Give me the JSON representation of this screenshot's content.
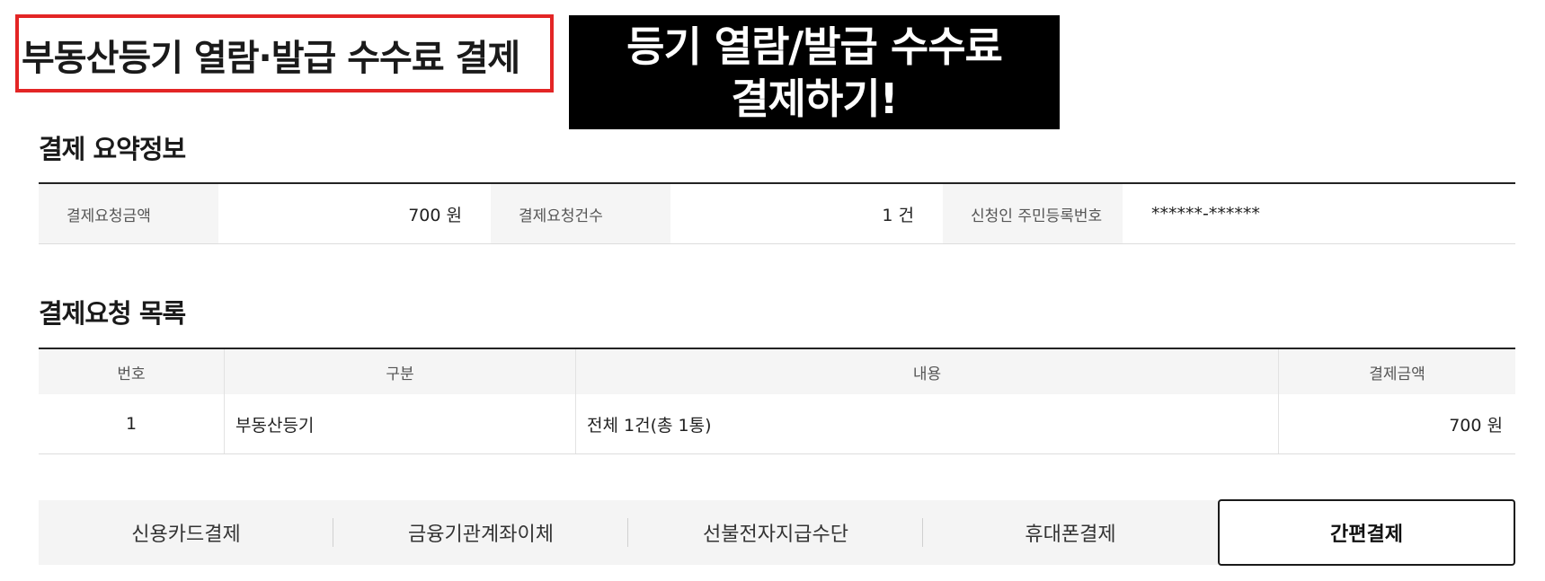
{
  "title": "부동산등기 열람·발급 수수료 결제",
  "banner": {
    "line1": "등기 열람/발급 수수료",
    "line2": "결제하기!"
  },
  "summary": {
    "heading": "결제 요약정보",
    "amount_label": "결제요청금액",
    "amount_value": "700 원",
    "count_label": "결제요청건수",
    "count_value": "1 건",
    "id_label": "신청인 주민등록번호",
    "id_value": "******-******"
  },
  "request_list": {
    "heading": "결제요청 목록",
    "columns": [
      "번호",
      "구분",
      "내용",
      "결제금액"
    ],
    "rows": [
      {
        "no": "1",
        "type": "부동산등기",
        "content": "전체 1건(총 1통)",
        "amount": "700 원"
      }
    ]
  },
  "payment_tabs": {
    "items": [
      "신용카드결제",
      "금융기관계좌이체",
      "선불전자지급수단",
      "휴대폰결제",
      "간편결제"
    ],
    "selected": "간편결제"
  },
  "colors": {
    "highlight_border": "#e32525",
    "banner_bg": "#000000",
    "banner_text": "#ffffff"
  }
}
